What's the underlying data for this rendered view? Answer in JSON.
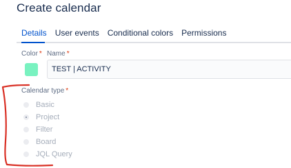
{
  "dialog": {
    "title": "Create calendar"
  },
  "tabs": [
    {
      "label": "Details",
      "active": true
    },
    {
      "label": "User events",
      "active": false
    },
    {
      "label": "Conditional colors",
      "active": false
    },
    {
      "label": "Permissions",
      "active": false
    }
  ],
  "fields": {
    "color": {
      "label": "Color",
      "required_mark": "*",
      "value": "#79f2c0"
    },
    "name": {
      "label": "Name",
      "required_mark": "*",
      "value": "TEST | ACTIVITY"
    },
    "calendar_type": {
      "label": "Calendar type",
      "required_mark": "*",
      "selected": "Project",
      "options": [
        "Basic",
        "Project",
        "Filter",
        "Board",
        "JQL Query"
      ]
    }
  },
  "colors": {
    "accent": "#0052cc",
    "required": "#de350b",
    "annotation": "#d93025"
  },
  "annotation": {
    "shape": "red freehand bracket around calendar type options"
  }
}
